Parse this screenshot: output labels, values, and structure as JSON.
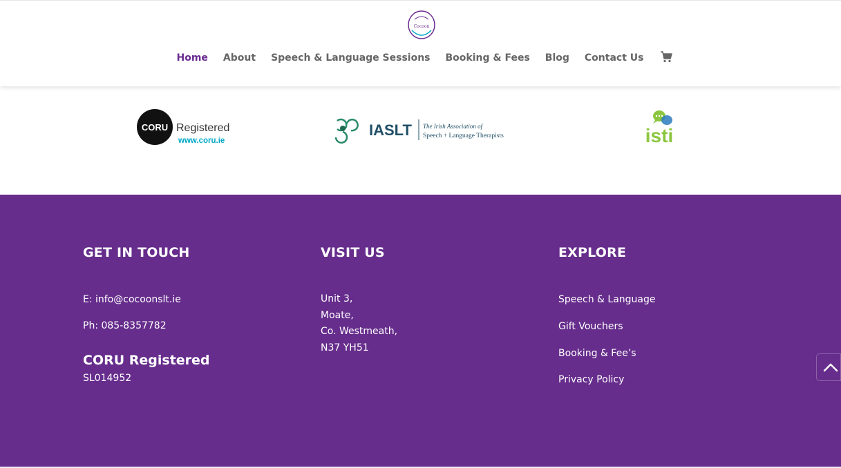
{
  "colors": {
    "brand_purple": "#662d8c",
    "nav_text": "#666666",
    "nav_active": "#6a2c91",
    "coru_teal": "#00a9c8",
    "iaslt_green": "#2a8a6a",
    "isti_green": "#8cc63f",
    "isti_blue": "#2a7bbd",
    "isti_orange": "#f39200"
  },
  "header": {
    "logo_icon": "cocoon-speech-therapy-logo",
    "nav": [
      "Home",
      "About",
      "Speech & Language Sessions",
      "Booking & Fees",
      "Blog",
      "Contact Us"
    ],
    "active_nav": "Home",
    "cart_icon": "shopping-cart-icon"
  },
  "logos": {
    "coru": {
      "name": "CORU",
      "text": "Registered",
      "url": "www.coru.ie"
    },
    "iaslt": {
      "name": "IASLT",
      "line1": "The Irish Association of",
      "line2": "Speech + Language Therapists"
    },
    "isti": {
      "name": "isti"
    }
  },
  "footer": {
    "get_in_touch": {
      "heading": "GET IN TOUCH",
      "email": "E: info@cocoonslt.ie",
      "phone": "Ph: 085-8357782",
      "coru_heading": "CORU Registered",
      "coru_number": "SL014952"
    },
    "visit_us": {
      "heading": "VISIT US",
      "address": [
        "Unit 3,",
        "Moate,",
        "Co. Westmeath,",
        "N37 YH51"
      ]
    },
    "explore": {
      "heading": "EXPLORE",
      "links": [
        "Speech & Language",
        "Gift Vouchers",
        "Booking & Fee’s",
        "Privacy Policy"
      ]
    }
  },
  "scroll_top_icon": "chevron-up-icon"
}
